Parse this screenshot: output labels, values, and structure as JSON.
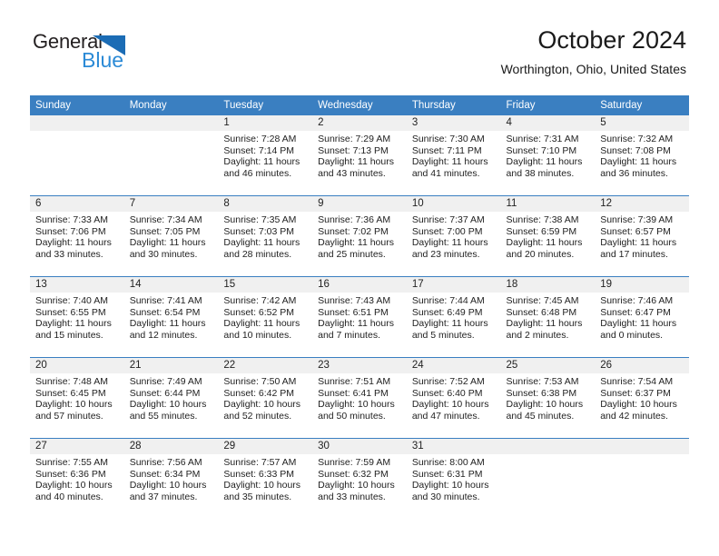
{
  "brand": {
    "word_one": "General",
    "word_two": "Blue",
    "triangle_icon": "triangle-logo-icon",
    "blue": "#2b8ad6",
    "dark_blue": "#1b6cb5"
  },
  "header": {
    "title": "October 2024",
    "subtitle": "Worthington, Ohio, United States"
  },
  "theme": {
    "header_blue": "#3a7fc1",
    "band_gray": "#f0f0f0",
    "text": "#222222"
  },
  "weekday_headers": [
    "Sunday",
    "Monday",
    "Tuesday",
    "Wednesday",
    "Thursday",
    "Friday",
    "Saturday"
  ],
  "labels": {
    "sunrise": "Sunrise:",
    "sunset": "Sunset:",
    "daylight": "Daylight:"
  },
  "weeks": [
    [
      {
        "day": "",
        "empty": true
      },
      {
        "day": "",
        "empty": true
      },
      {
        "day": "1",
        "sunrise": "Sunrise: 7:28 AM",
        "sunset": "Sunset: 7:14 PM",
        "daylight": "Daylight: 11 hours and 46 minutes."
      },
      {
        "day": "2",
        "sunrise": "Sunrise: 7:29 AM",
        "sunset": "Sunset: 7:13 PM",
        "daylight": "Daylight: 11 hours and 43 minutes."
      },
      {
        "day": "3",
        "sunrise": "Sunrise: 7:30 AM",
        "sunset": "Sunset: 7:11 PM",
        "daylight": "Daylight: 11 hours and 41 minutes."
      },
      {
        "day": "4",
        "sunrise": "Sunrise: 7:31 AM",
        "sunset": "Sunset: 7:10 PM",
        "daylight": "Daylight: 11 hours and 38 minutes."
      },
      {
        "day": "5",
        "sunrise": "Sunrise: 7:32 AM",
        "sunset": "Sunset: 7:08 PM",
        "daylight": "Daylight: 11 hours and 36 minutes."
      }
    ],
    [
      {
        "day": "6",
        "sunrise": "Sunrise: 7:33 AM",
        "sunset": "Sunset: 7:06 PM",
        "daylight": "Daylight: 11 hours and 33 minutes."
      },
      {
        "day": "7",
        "sunrise": "Sunrise: 7:34 AM",
        "sunset": "Sunset: 7:05 PM",
        "daylight": "Daylight: 11 hours and 30 minutes."
      },
      {
        "day": "8",
        "sunrise": "Sunrise: 7:35 AM",
        "sunset": "Sunset: 7:03 PM",
        "daylight": "Daylight: 11 hours and 28 minutes."
      },
      {
        "day": "9",
        "sunrise": "Sunrise: 7:36 AM",
        "sunset": "Sunset: 7:02 PM",
        "daylight": "Daylight: 11 hours and 25 minutes."
      },
      {
        "day": "10",
        "sunrise": "Sunrise: 7:37 AM",
        "sunset": "Sunset: 7:00 PM",
        "daylight": "Daylight: 11 hours and 23 minutes."
      },
      {
        "day": "11",
        "sunrise": "Sunrise: 7:38 AM",
        "sunset": "Sunset: 6:59 PM",
        "daylight": "Daylight: 11 hours and 20 minutes."
      },
      {
        "day": "12",
        "sunrise": "Sunrise: 7:39 AM",
        "sunset": "Sunset: 6:57 PM",
        "daylight": "Daylight: 11 hours and 17 minutes."
      }
    ],
    [
      {
        "day": "13",
        "sunrise": "Sunrise: 7:40 AM",
        "sunset": "Sunset: 6:55 PM",
        "daylight": "Daylight: 11 hours and 15 minutes."
      },
      {
        "day": "14",
        "sunrise": "Sunrise: 7:41 AM",
        "sunset": "Sunset: 6:54 PM",
        "daylight": "Daylight: 11 hours and 12 minutes."
      },
      {
        "day": "15",
        "sunrise": "Sunrise: 7:42 AM",
        "sunset": "Sunset: 6:52 PM",
        "daylight": "Daylight: 11 hours and 10 minutes."
      },
      {
        "day": "16",
        "sunrise": "Sunrise: 7:43 AM",
        "sunset": "Sunset: 6:51 PM",
        "daylight": "Daylight: 11 hours and 7 minutes."
      },
      {
        "day": "17",
        "sunrise": "Sunrise: 7:44 AM",
        "sunset": "Sunset: 6:49 PM",
        "daylight": "Daylight: 11 hours and 5 minutes."
      },
      {
        "day": "18",
        "sunrise": "Sunrise: 7:45 AM",
        "sunset": "Sunset: 6:48 PM",
        "daylight": "Daylight: 11 hours and 2 minutes."
      },
      {
        "day": "19",
        "sunrise": "Sunrise: 7:46 AM",
        "sunset": "Sunset: 6:47 PM",
        "daylight": "Daylight: 11 hours and 0 minutes."
      }
    ],
    [
      {
        "day": "20",
        "sunrise": "Sunrise: 7:48 AM",
        "sunset": "Sunset: 6:45 PM",
        "daylight": "Daylight: 10 hours and 57 minutes."
      },
      {
        "day": "21",
        "sunrise": "Sunrise: 7:49 AM",
        "sunset": "Sunset: 6:44 PM",
        "daylight": "Daylight: 10 hours and 55 minutes."
      },
      {
        "day": "22",
        "sunrise": "Sunrise: 7:50 AM",
        "sunset": "Sunset: 6:42 PM",
        "daylight": "Daylight: 10 hours and 52 minutes."
      },
      {
        "day": "23",
        "sunrise": "Sunrise: 7:51 AM",
        "sunset": "Sunset: 6:41 PM",
        "daylight": "Daylight: 10 hours and 50 minutes."
      },
      {
        "day": "24",
        "sunrise": "Sunrise: 7:52 AM",
        "sunset": "Sunset: 6:40 PM",
        "daylight": "Daylight: 10 hours and 47 minutes."
      },
      {
        "day": "25",
        "sunrise": "Sunrise: 7:53 AM",
        "sunset": "Sunset: 6:38 PM",
        "daylight": "Daylight: 10 hours and 45 minutes."
      },
      {
        "day": "26",
        "sunrise": "Sunrise: 7:54 AM",
        "sunset": "Sunset: 6:37 PM",
        "daylight": "Daylight: 10 hours and 42 minutes."
      }
    ],
    [
      {
        "day": "27",
        "sunrise": "Sunrise: 7:55 AM",
        "sunset": "Sunset: 6:36 PM",
        "daylight": "Daylight: 10 hours and 40 minutes."
      },
      {
        "day": "28",
        "sunrise": "Sunrise: 7:56 AM",
        "sunset": "Sunset: 6:34 PM",
        "daylight": "Daylight: 10 hours and 37 minutes."
      },
      {
        "day": "29",
        "sunrise": "Sunrise: 7:57 AM",
        "sunset": "Sunset: 6:33 PM",
        "daylight": "Daylight: 10 hours and 35 minutes."
      },
      {
        "day": "30",
        "sunrise": "Sunrise: 7:59 AM",
        "sunset": "Sunset: 6:32 PM",
        "daylight": "Daylight: 10 hours and 33 minutes."
      },
      {
        "day": "31",
        "sunrise": "Sunrise: 8:00 AM",
        "sunset": "Sunset: 6:31 PM",
        "daylight": "Daylight: 10 hours and 30 minutes."
      },
      {
        "day": "",
        "empty": true
      },
      {
        "day": "",
        "empty": true
      }
    ]
  ]
}
